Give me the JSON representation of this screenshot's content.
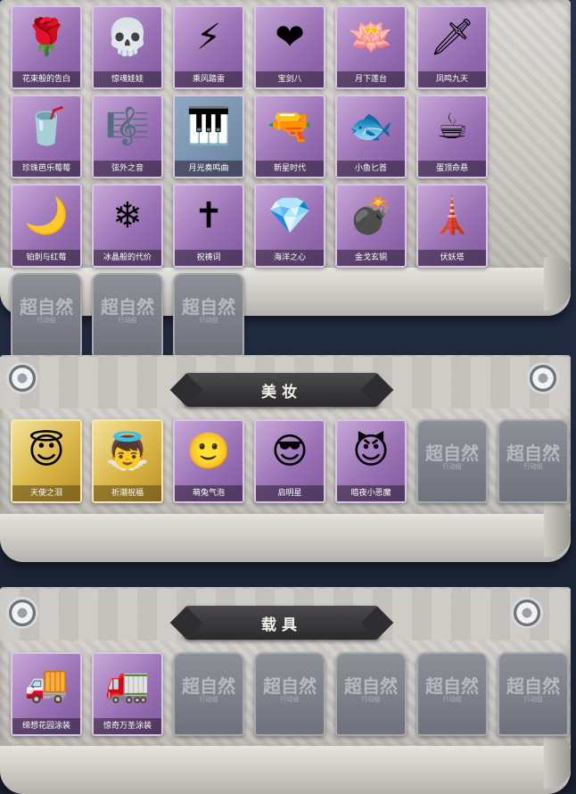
{
  "sections": [
    {
      "id": "accessories",
      "title": "",
      "items": [
        {
          "label": "花束般的告白",
          "icon": "rose-icon",
          "glyph": "🌹",
          "tier": "purple"
        },
        {
          "label": "惊魂娃娃",
          "icon": "skull-doll-icon",
          "glyph": "💀",
          "tier": "purple"
        },
        {
          "label": "乘风踏雷",
          "icon": "thunder-gear-icon",
          "glyph": "⚡",
          "tier": "purple"
        },
        {
          "label": "宝剑八",
          "icon": "heart-emblem-icon",
          "glyph": "❤",
          "tier": "purple"
        },
        {
          "label": "月下莲台",
          "icon": "lotus-pendant-icon",
          "glyph": "🪷",
          "tier": "purple"
        },
        {
          "label": "凤鸣九天",
          "icon": "red-blade-icon",
          "glyph": "🗡",
          "tier": "purple"
        },
        {
          "label": "珍珠芭乐莓莓",
          "icon": "bubble-tea-icon",
          "glyph": "🥤",
          "tier": "purple"
        },
        {
          "label": "弦外之音",
          "icon": "golden-staff-icon",
          "glyph": "🎼",
          "tier": "purple"
        },
        {
          "label": "月光奏鸣曲",
          "icon": "piano-cloud-icon",
          "glyph": "🎹",
          "tier": "empty-blue"
        },
        {
          "label": "新星时代",
          "icon": "revolver-icon",
          "glyph": "🔫",
          "tier": "purple"
        },
        {
          "label": "小鱼匕首",
          "icon": "fish-dagger-icon",
          "glyph": "🐟",
          "tier": "purple"
        },
        {
          "label": "蛋顶命悬",
          "icon": "teacup-icon",
          "glyph": "☕",
          "tier": "purple"
        },
        {
          "label": "铂刺与红莓",
          "icon": "scythe-icon",
          "glyph": "🌙",
          "tier": "purple"
        },
        {
          "label": "冰晶般的代价",
          "icon": "crystal-flower-icon",
          "glyph": "❄",
          "tier": "purple"
        },
        {
          "label": "祝祷词",
          "icon": "cross-pendant-icon",
          "glyph": "✝",
          "tier": "purple"
        },
        {
          "label": "海洋之心",
          "icon": "sapphire-necklace-icon",
          "glyph": "💎",
          "tier": "purple"
        },
        {
          "label": "金戈玄铜",
          "icon": "grenade-icon",
          "glyph": "💣",
          "tier": "purple"
        },
        {
          "label": "伏妖塔",
          "icon": "pagoda-icon",
          "glyph": "🗼",
          "tier": "purple"
        },
        {
          "label": "",
          "icon": "locked-slot-icon",
          "glyph": "",
          "tier": "empty"
        },
        {
          "label": "",
          "icon": "locked-slot-icon",
          "glyph": "",
          "tier": "empty"
        },
        {
          "label": "",
          "icon": "locked-slot-icon",
          "glyph": "",
          "tier": "empty"
        }
      ]
    },
    {
      "id": "makeup",
      "title": "美妆",
      "items": [
        {
          "label": "天使之泪",
          "icon": "angel-halo-icon",
          "glyph": "😇",
          "tier": "gold"
        },
        {
          "label": "祈潮祝福",
          "icon": "wing-crown-icon",
          "glyph": "👼",
          "tier": "gold"
        },
        {
          "label": "萌兔气泡",
          "icon": "halo-face-icon",
          "glyph": "🙂",
          "tier": "purple"
        },
        {
          "label": "启明星",
          "icon": "star-glasses-icon",
          "glyph": "😎",
          "tier": "purple"
        },
        {
          "label": "暗夜小恶魔",
          "icon": "devil-horns-icon",
          "glyph": "😈",
          "tier": "purple"
        },
        {
          "label": "",
          "icon": "locked-slot-icon",
          "glyph": "",
          "tier": "empty"
        },
        {
          "label": "",
          "icon": "locked-slot-icon",
          "glyph": "",
          "tier": "empty"
        }
      ]
    },
    {
      "id": "vehicles",
      "title": "载具",
      "items": [
        {
          "label": "缔想花园涂装",
          "icon": "rose-truck-icon",
          "glyph": "🚚",
          "tier": "purple"
        },
        {
          "label": "惊奇万圣涂装",
          "icon": "halloween-truck-icon",
          "glyph": "🚛",
          "tier": "purple"
        },
        {
          "label": "",
          "icon": "locked-slot-icon",
          "glyph": "",
          "tier": "empty"
        },
        {
          "label": "",
          "icon": "locked-slot-icon",
          "glyph": "",
          "tier": "empty"
        },
        {
          "label": "",
          "icon": "locked-slot-icon",
          "glyph": "",
          "tier": "empty"
        },
        {
          "label": "",
          "icon": "locked-slot-icon",
          "glyph": "",
          "tier": "empty"
        },
        {
          "label": "",
          "icon": "locked-slot-icon",
          "glyph": "",
          "tier": "empty"
        }
      ]
    }
  ],
  "watermark": {
    "main": "超自然",
    "sub": "行动组"
  },
  "colors": {
    "purple": "#9a72b5",
    "gold": "#d9b545",
    "empty": "#7d8088",
    "title_plate": "#3a3a3c"
  }
}
